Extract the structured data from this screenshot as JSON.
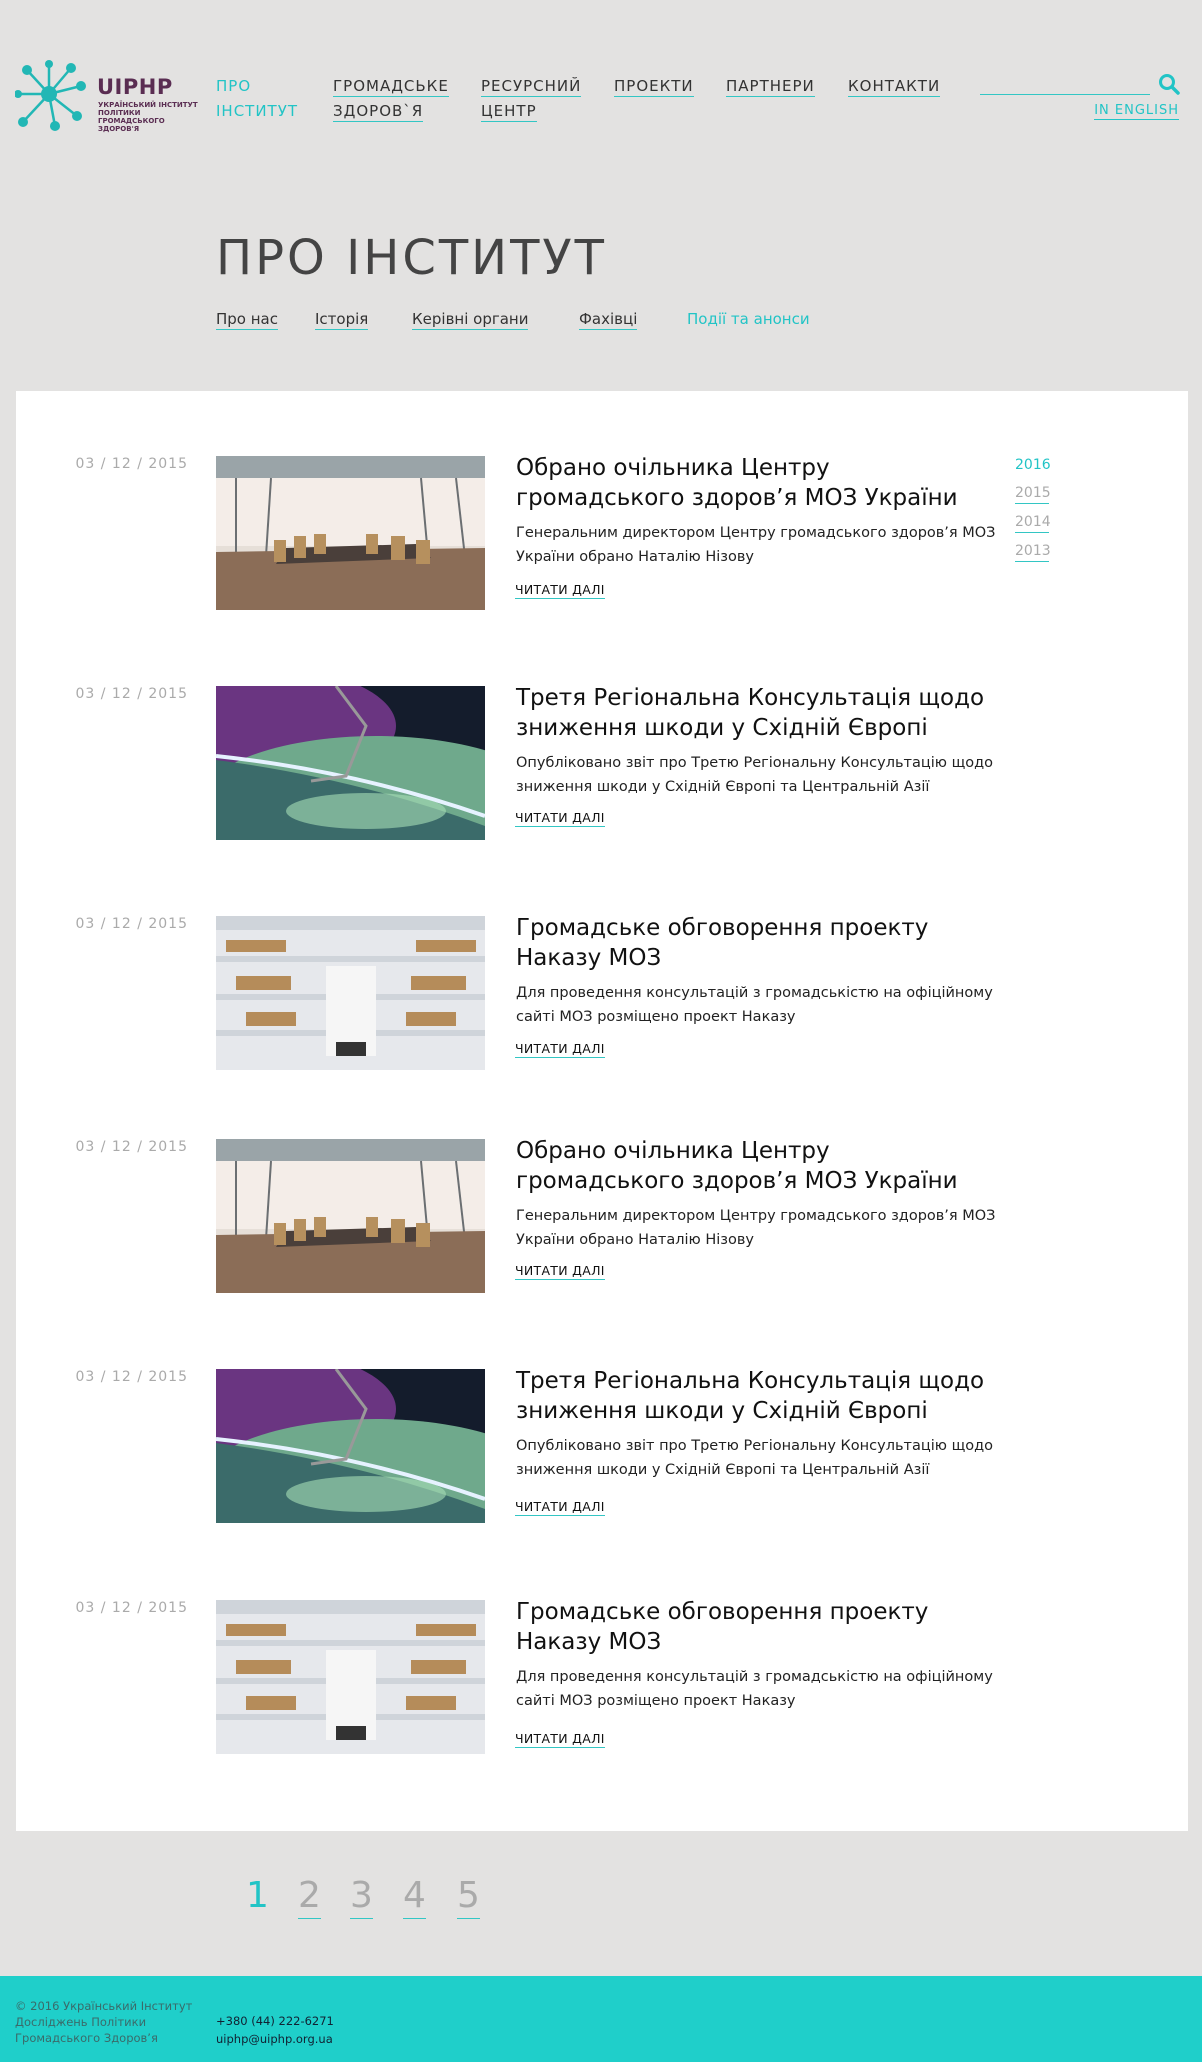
{
  "logo": {
    "name": "UIPHP",
    "subtitle": "УКРАЇНСЬКИЙ ІНСТИТУТ ПОЛІТИКИ ГРОМАДСЬКОГО ЗДОРОВ'Я",
    "color": "#5a2d52",
    "accent": "#22c4c6"
  },
  "nav": {
    "items": [
      {
        "line1": "ПРО",
        "line2": "ІНСТИТУТ",
        "active": true
      },
      {
        "line1": "ГРОМАДСЬКЕ",
        "line2": "ЗДОРОВ`Я",
        "active": false
      },
      {
        "line1": "РЕСУРСНИЙ",
        "line2": "ЦЕНТР",
        "active": false
      },
      {
        "line1": "ПРОЕКТИ",
        "line2": "",
        "active": false
      },
      {
        "line1": "ПАРТНЕРИ",
        "line2": "",
        "active": false
      },
      {
        "line1": "КОНТАКТИ",
        "line2": "",
        "active": false
      }
    ],
    "search_icon": "search-icon",
    "language": "IN ENGLISH"
  },
  "page": {
    "title": "ПРО ІНСТИТУТ"
  },
  "subnav": {
    "items": [
      "Про нас",
      "Історія",
      "Керівні органи",
      "Фахівці",
      "Події та анонси"
    ],
    "active_index": 4
  },
  "articles": [
    {
      "date": "03 / 12 / 2015",
      "title": "Обрано очільника Центру громадського здоров’я МОЗ України",
      "description": "Генеральним директором Центру громадського здоров’я МОЗ України обрано Наталію Нізову",
      "read_more": "ЧИТАТИ ДАЛІ",
      "image": "conference-room"
    },
    {
      "date": "03 / 12 / 2015",
      "title": "Третя Регіональна Консультація щодо зниження шкоди у Східній Європі",
      "description": "Опубліковано звіт про Третю Регіональну Консультацію щодо зниження шкоди у Східній Європі та Центральній Азії",
      "read_more": "ЧИТАТИ ДАЛІ",
      "image": "earth-aurora"
    },
    {
      "date": "03 / 12 / 2015",
      "title": "Громадське обговорення проекту Наказу МОЗ",
      "description": "Для проведення консультацій з громадськістю на офіційному сайті МОЗ розміщено проект Наказу",
      "read_more": "ЧИТАТИ ДАЛІ",
      "image": "library"
    },
    {
      "date": "03 / 12 / 2015",
      "title": "Обрано очільника Центру громадського здоров’я МОЗ України",
      "description": "Генеральним директором Центру громадського здоров’я МОЗ України обрано Наталію Нізову",
      "read_more": "ЧИТАТИ ДАЛІ",
      "image": "conference-room"
    },
    {
      "date": "03 / 12 / 2015",
      "title": "Третя Регіональна Консультація щодо зниження шкоди у Східній Європі",
      "description": "Опубліковано звіт про Третю Регіональну Консультацію щодо зниження шкоди у Східній Європі та Центральній Азії",
      "read_more": "ЧИТАТИ ДАЛІ",
      "image": "earth-aurora"
    },
    {
      "date": "03 / 12 / 2015",
      "title": "Громадське обговорення проекту Наказу МОЗ",
      "description": "Для проведення консультацій з громадськістю на офіційному сайті МОЗ розміщено проект Наказу",
      "read_more": "ЧИТАТИ ДАЛІ",
      "image": "library"
    }
  ],
  "years": {
    "items": [
      "2016",
      "2015",
      "2014",
      "2013"
    ],
    "active_index": 0
  },
  "pagination": {
    "pages": [
      "1",
      "2",
      "3",
      "4",
      "5"
    ],
    "active_index": 0
  },
  "footer": {
    "copyright": "© 2016 Український Інститут Досліджень Політики Громадського Здоров’я",
    "phone": "+380 (44) 222-6271",
    "email": "uiphp@uiphp.org.ua",
    "background": "#1fcfca"
  }
}
